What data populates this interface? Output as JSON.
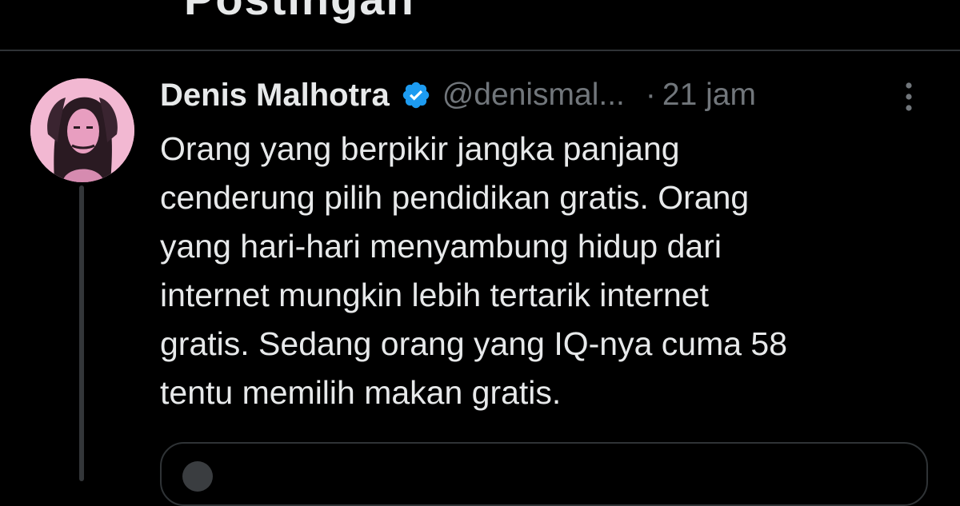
{
  "header": {
    "title_fragment": "Postingan"
  },
  "tweet": {
    "display_name": "Denis Malhotra",
    "verified": true,
    "handle": "@denismal...",
    "separator": "·",
    "time": "21 jam",
    "text_lines": [
      "Orang yang berpikir jangka panjang",
      "cenderung pilih pendidikan gratis. Orang",
      "yang hari-hari menyambung hidup dari",
      "internet mungkin lebih tertarik internet",
      "gratis. Sedang orang yang IQ-nya cuma 58",
      "tentu memilih makan gratis."
    ]
  },
  "icons": {
    "verified": "verified-badge-icon",
    "more": "more-options-icon"
  },
  "colors": {
    "background": "#000000",
    "text_primary": "#e7e9ea",
    "text_secondary": "#71767b",
    "verified_blue": "#1d9bf0",
    "divider": "#2f3336",
    "avatar_bg": "#f2b8d2"
  }
}
